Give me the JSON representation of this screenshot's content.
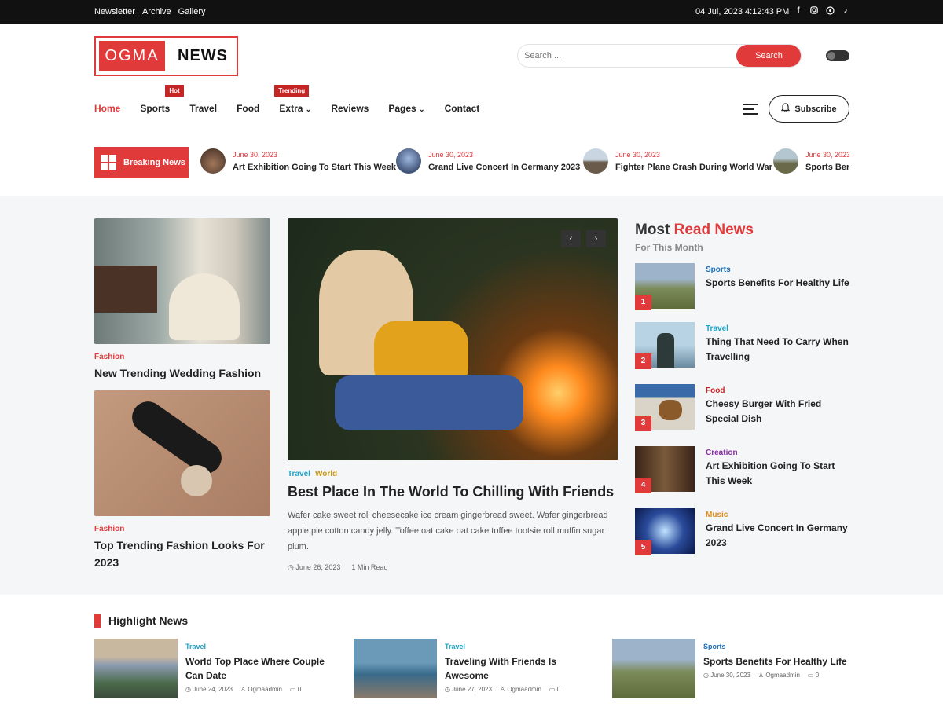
{
  "topbar": {
    "links": [
      "Newsletter",
      "Archive",
      "Gallery"
    ],
    "datetime": "04 Jul, 2023 4:12:43 PM",
    "social_icons": [
      "facebook-icon",
      "instagram-icon",
      "whatsapp-icon",
      "tiktok-icon"
    ]
  },
  "logo": {
    "part1": "OGMA",
    "part2": "NEWS"
  },
  "search": {
    "placeholder": "Search ...",
    "button": "Search"
  },
  "nav": {
    "items": [
      {
        "label": "Home",
        "active": true
      },
      {
        "label": "Sports",
        "badge": "Hot"
      },
      {
        "label": "Travel"
      },
      {
        "label": "Food"
      },
      {
        "label": "Extra",
        "badge": "Trending",
        "dropdown": true
      },
      {
        "label": "Reviews"
      },
      {
        "label": "Pages",
        "dropdown": true
      },
      {
        "label": "Contact"
      }
    ],
    "subscribe": "Subscribe"
  },
  "breaking": {
    "label": "Breaking News",
    "items": [
      {
        "date": "June 30, 2023",
        "title": "Art Exhibition Going To Start This Week"
      },
      {
        "date": "June 30, 2023",
        "title": "Grand Live Concert In Germany 2023"
      },
      {
        "date": "June 30, 2023",
        "title": "Fighter Plane Crash During World War"
      },
      {
        "date": "June 30, 2023",
        "title": "Sports Ben"
      }
    ]
  },
  "left_cards": [
    {
      "category": "Fashion",
      "title": "New Trending Wedding Fashion"
    },
    {
      "category": "Fashion",
      "title": "Top Trending Fashion Looks For 2023"
    }
  ],
  "feature": {
    "categories": [
      "Travel",
      "World"
    ],
    "title": "Best Place In The World To Chilling With Friends",
    "description": "Wafer cake sweet roll cheesecake ice cream gingerbread sweet. Wafer gingerbread apple pie cotton candy jelly. Toffee oat cake oat cake toffee tootsie roll muffin sugar plum.",
    "date": "June 26, 2023",
    "read_time": "1 Min Read",
    "prev": "‹",
    "next": "›"
  },
  "most_read": {
    "title_a": "Most",
    "title_b": "Read News",
    "subtitle": "For This Month",
    "items": [
      {
        "num": "1",
        "category": "Sports",
        "color": "#1e6fb8",
        "title": "Sports Benefits For Healthy Life"
      },
      {
        "num": "2",
        "category": "Travel",
        "color": "#1ea3c8",
        "title": "Thing That Need To Carry When Travelling"
      },
      {
        "num": "3",
        "category": "Food",
        "color": "#c42626",
        "title": "Cheesy Burger With Fried Special Dish"
      },
      {
        "num": "4",
        "category": "Creation",
        "color": "#8a2ca8",
        "title": "Art Exhibition Going To Start This Week"
      },
      {
        "num": "5",
        "category": "Music",
        "color": "#e08a1e",
        "title": "Grand Live Concert In Germany 2023"
      }
    ]
  },
  "highlight": {
    "title": "Highlight News",
    "items": [
      {
        "category": "Travel",
        "title": "World Top Place Where Couple Can Date",
        "date": "June 24, 2023",
        "author": "Ogmaadmin",
        "comments": "0"
      },
      {
        "category": "Travel",
        "title": "Traveling With Friends Is Awesome",
        "date": "June 27, 2023",
        "author": "Ogmaadmin",
        "comments": "0"
      },
      {
        "category": "Sports",
        "title": "Sports Benefits For Healthy Life",
        "date": "June 30, 2023",
        "author": "Ogmaadmin",
        "comments": "0"
      }
    ]
  },
  "colors": {
    "accent": "#e03a3a",
    "travel": "#1ea3c8",
    "world": "#c79a1a"
  }
}
